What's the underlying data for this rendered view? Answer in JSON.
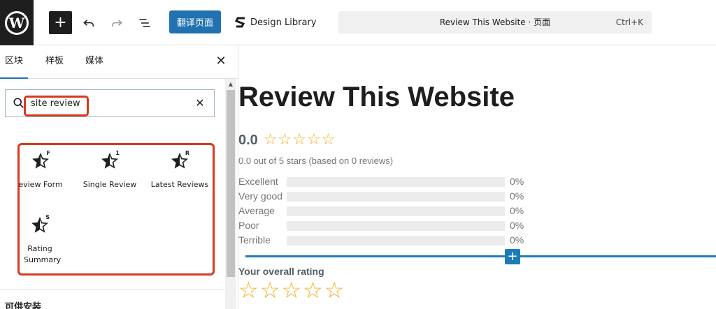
{
  "topbar": {
    "logo_letter": "W",
    "inserter_symbol": "+",
    "translate_label": "翻译页面",
    "design_library_label": "Design Library",
    "command_title": "Review This Website · 页面",
    "command_shortcut": "Ctrl+K"
  },
  "sidebar": {
    "tabs": [
      {
        "label": "区块",
        "active": true
      },
      {
        "label": "样板",
        "active": false
      },
      {
        "label": "媒体",
        "active": false
      }
    ],
    "close_symbol": "✕",
    "search": {
      "value": "site review",
      "clear_symbol": "✕"
    },
    "blocks": [
      {
        "label": "eview Form",
        "badge": "F"
      },
      {
        "label": "Single Review",
        "badge": "1"
      },
      {
        "label": "Latest Reviews",
        "badge": "R"
      },
      {
        "label": "Rating Summary",
        "badge": "S"
      }
    ],
    "more_heading": "可供安装"
  },
  "canvas": {
    "title": "Review This Website",
    "average": "0.0",
    "average_rating_fraction": 0,
    "summary": "0.0 out of 5 stars (based on 0 reviews)",
    "distribution": [
      {
        "label": "Excellent",
        "percent": 0,
        "percent_text": "0%"
      },
      {
        "label": "Very good",
        "percent": 0,
        "percent_text": "0%"
      },
      {
        "label": "Average",
        "percent": 0,
        "percent_text": "0%"
      },
      {
        "label": "Poor",
        "percent": 0,
        "percent_text": "0%"
      },
      {
        "label": "Terrible",
        "percent": 0,
        "percent_text": "0%"
      }
    ],
    "append_symbol": "+",
    "overall_label": "Your overall rating",
    "overall_rating": 0
  },
  "colors": {
    "accent": "#2271b1",
    "star": "#f2b01e",
    "highlight": "#d9381e",
    "append_line": "#1c7cb8"
  }
}
